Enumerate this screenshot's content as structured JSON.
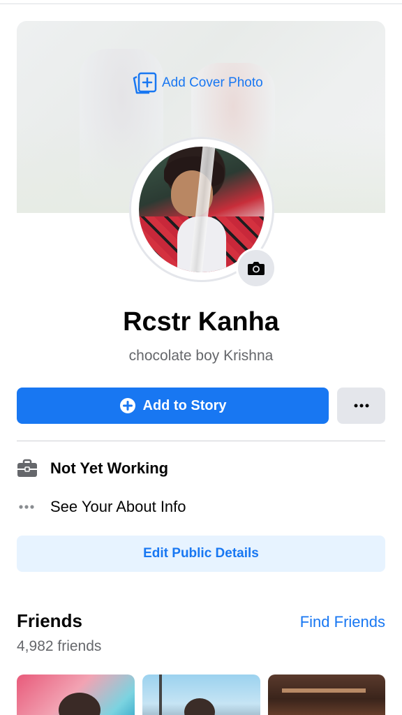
{
  "cover": {
    "add_cover_label": "Add Cover Photo"
  },
  "profile": {
    "name": "Rcstr Kanha",
    "bio": "chocolate boy Krishna"
  },
  "actions": {
    "add_story_label": "Add to Story",
    "more_icon": "ellipsis-icon"
  },
  "details": {
    "work": "Not Yet Working",
    "about": "See Your About Info",
    "edit_label": "Edit Public Details"
  },
  "friends": {
    "title": "Friends",
    "find_label": "Find Friends",
    "count": "4,982 friends"
  },
  "colors": {
    "accent": "#1877f2",
    "secondary_bg": "#e4e6eb",
    "light_accent_bg": "#e7f3ff",
    "muted_text": "#65676b"
  }
}
